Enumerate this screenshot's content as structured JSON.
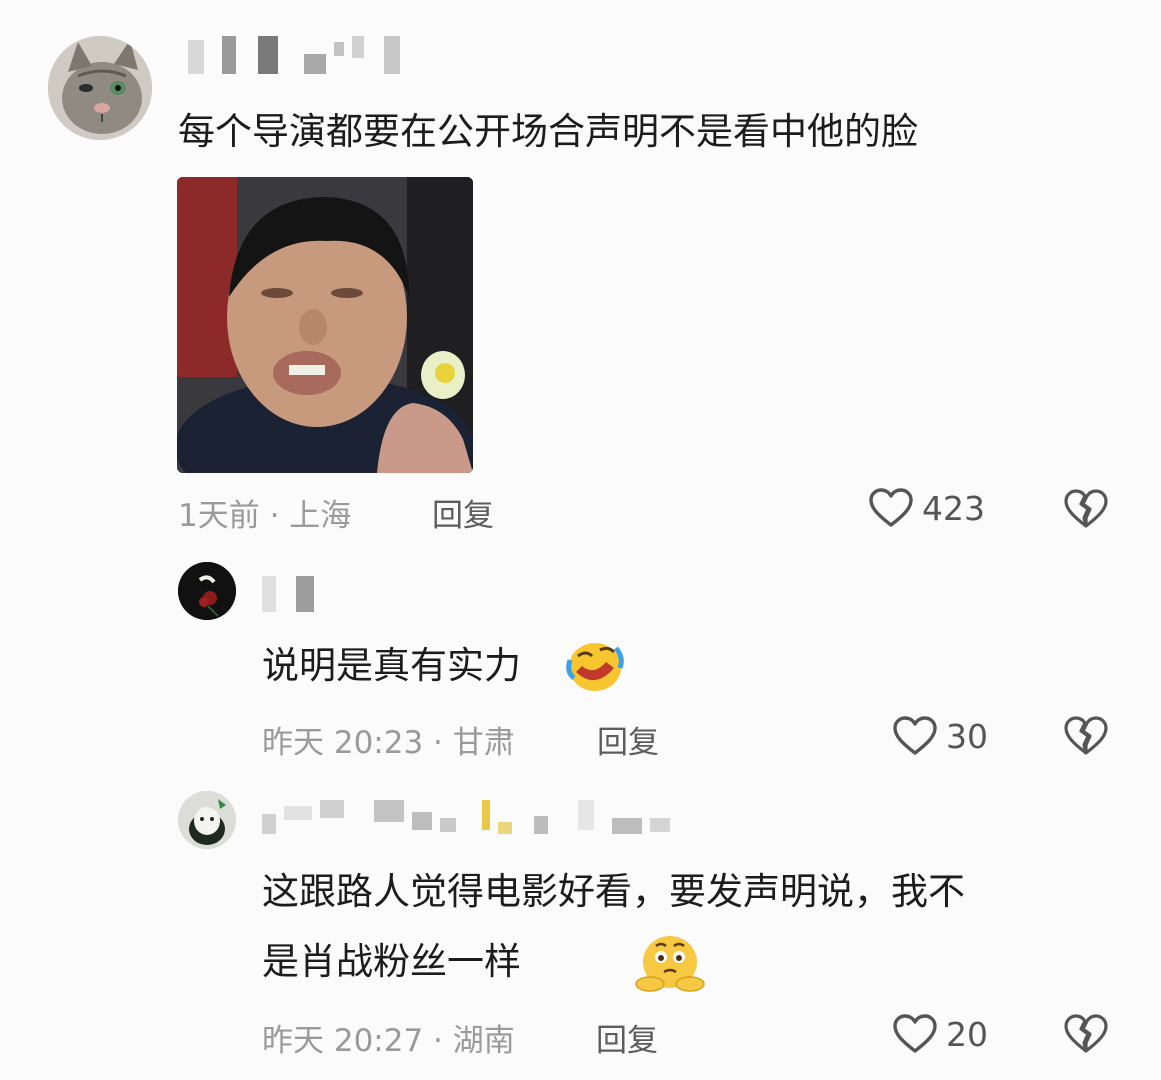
{
  "comments": [
    {
      "text": "每个导演都要在公开场合声明不是看中他的脸",
      "time_location": "1天前 · 上海",
      "reply_label": "回复",
      "likes": "423"
    },
    {
      "text": "说明是真有实力",
      "time_location": "昨天 20:23 · 甘肃",
      "reply_label": "回复",
      "likes": "30"
    },
    {
      "text_line1": "这跟路人觉得电影好看，要发声明说，我不",
      "text_line2": "是肖战粉丝一样",
      "time_location": "昨天 20:27 · 湖南",
      "reply_label": "回复",
      "likes": "20"
    }
  ],
  "colors": {
    "background": "#fbfbfb",
    "text_primary": "#1c1c1c",
    "text_meta": "#9a9a9a",
    "icon_gray": "#555555"
  },
  "icons": {
    "like": "heart-outline-icon",
    "dislike": "broken-heart-icon",
    "emoji_1": "rolling-laugh-emoji",
    "emoji_2": "thinking-emoji"
  }
}
